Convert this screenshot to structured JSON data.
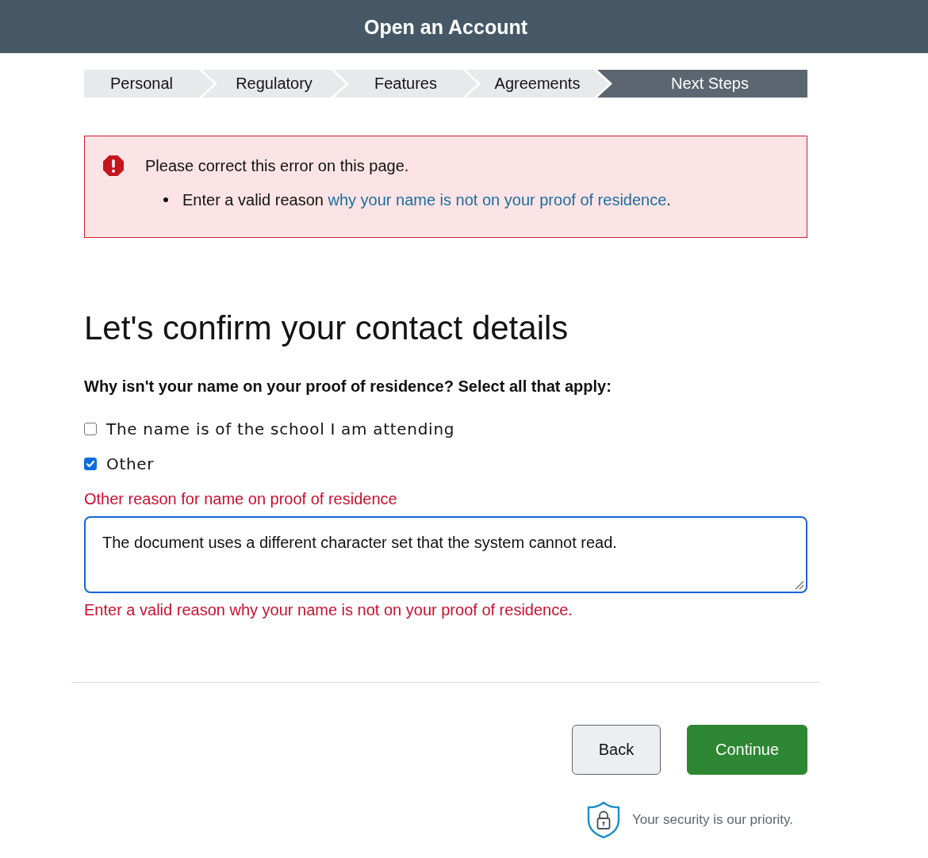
{
  "header": {
    "title": "Open an Account"
  },
  "steps": [
    {
      "label": "Personal",
      "selected": false
    },
    {
      "label": "Regulatory",
      "selected": false
    },
    {
      "label": "Features",
      "selected": false
    },
    {
      "label": "Agreements",
      "selected": false
    },
    {
      "label": "Next Steps",
      "selected": true
    }
  ],
  "error_summary": {
    "message": "Please correct this error on this page.",
    "items": [
      {
        "text": "Enter a valid reason ",
        "link": "why your name is not on your proof of residence",
        "suffix": "."
      }
    ]
  },
  "heading": "Let's confirm your contact details",
  "question": "Why isn't your name on your proof of residence? Select all that apply:",
  "options": [
    {
      "label": "The name is of the school I am attending",
      "checked": false
    },
    {
      "label": "Other",
      "checked": true
    }
  ],
  "other_reason": {
    "label": "Other reason for name on proof of residence",
    "value": "The document uses a different character set that the system cannot read.",
    "focused": true,
    "invalid": true,
    "error": "Enter a valid reason why your name is not on your proof of residence."
  },
  "buttons": [
    {
      "label": "Back",
      "kind": "secondary"
    },
    {
      "label": "Continue",
      "kind": "primary"
    }
  ],
  "security_note": "Your security is our priority."
}
